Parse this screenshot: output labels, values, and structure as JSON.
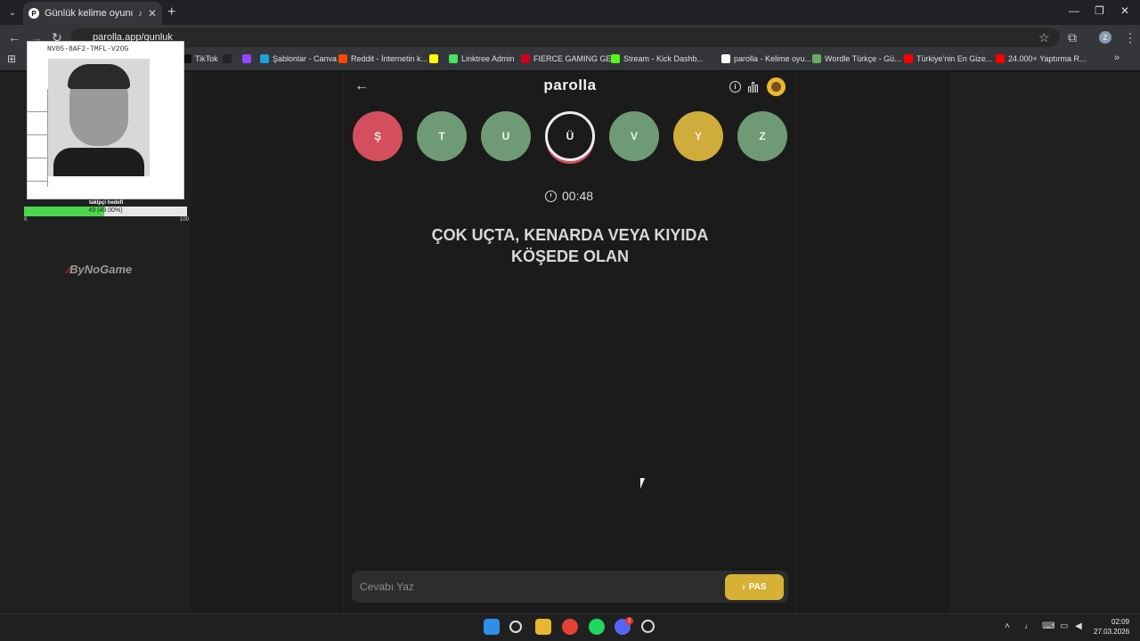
{
  "browser": {
    "tab_title": "Günlük kelime oyunu - parolla",
    "tab_favicon_letter": "P",
    "url": "parolla.app/gunluk",
    "bookmarks": [
      {
        "label": "TikTok",
        "color": "#111111"
      },
      {
        "label": "",
        "color": "#222222"
      },
      {
        "label": "",
        "color": "#9146ff"
      },
      {
        "label": "Şablonlar - Canva",
        "color": "#1fa0d8"
      },
      {
        "label": "Reddit - İnternetin k...",
        "color": "#ff4500"
      },
      {
        "label": "",
        "color": "#fffc00"
      },
      {
        "label": "Linktree Admin",
        "color": "#43e55e"
      },
      {
        "label": "FIERCE GAMING GE...",
        "color": "#d1001f"
      },
      {
        "label": "Stream - Kick Dashb...",
        "color": "#53fc18"
      },
      {
        "label": "",
        "color": "#333333"
      },
      {
        "label": "parolla - Kelime oyu...",
        "color": "#ffffff"
      },
      {
        "label": "Wordle Türkçe - Gü...",
        "color": "#6aaa64"
      },
      {
        "label": "Türkiye'nin En Gize...",
        "color": "#ff0000"
      },
      {
        "label": "24.000+ Yaptırma R...",
        "color": "#ff0000"
      }
    ]
  },
  "overlay": {
    "card_code": "NV05-8AF2-TMFL-V2OG",
    "progress_label": "takipçi hedefi",
    "progress_text": "49 (49.00%)",
    "progress_value": 0.49,
    "progress_min": "0",
    "progress_max": "100",
    "sponsor": "ByNoGame",
    "sponsor_mark": "⁄"
  },
  "game": {
    "logo": "parolla",
    "back_icon": "arrow-left-icon",
    "letters": [
      {
        "char": "Ş",
        "state": "red"
      },
      {
        "char": "T",
        "state": "green"
      },
      {
        "char": "U",
        "state": "green"
      },
      {
        "char": "Ü",
        "state": "active"
      },
      {
        "char": "V",
        "state": "green"
      },
      {
        "char": "Y",
        "state": "yellow"
      },
      {
        "char": "Z",
        "state": "green"
      }
    ],
    "timer": "00:48",
    "question_line1": "ÇOK UÇTA, KENARDA VEYA KIYIDA",
    "question_line2": "KÖŞEDE OLAN",
    "answer_placeholder": "Cevabı Yaz",
    "pass_label": "PAS",
    "pass_icon": "chevron-right-icon"
  },
  "taskbar": {
    "time": "02:09",
    "date": "27.03.2026",
    "discord_badge": "2"
  },
  "colors": {
    "red": "#d34f5e",
    "green": "#6f9a76",
    "yellow": "#cfac3b",
    "pass_button": "#d7b036"
  }
}
